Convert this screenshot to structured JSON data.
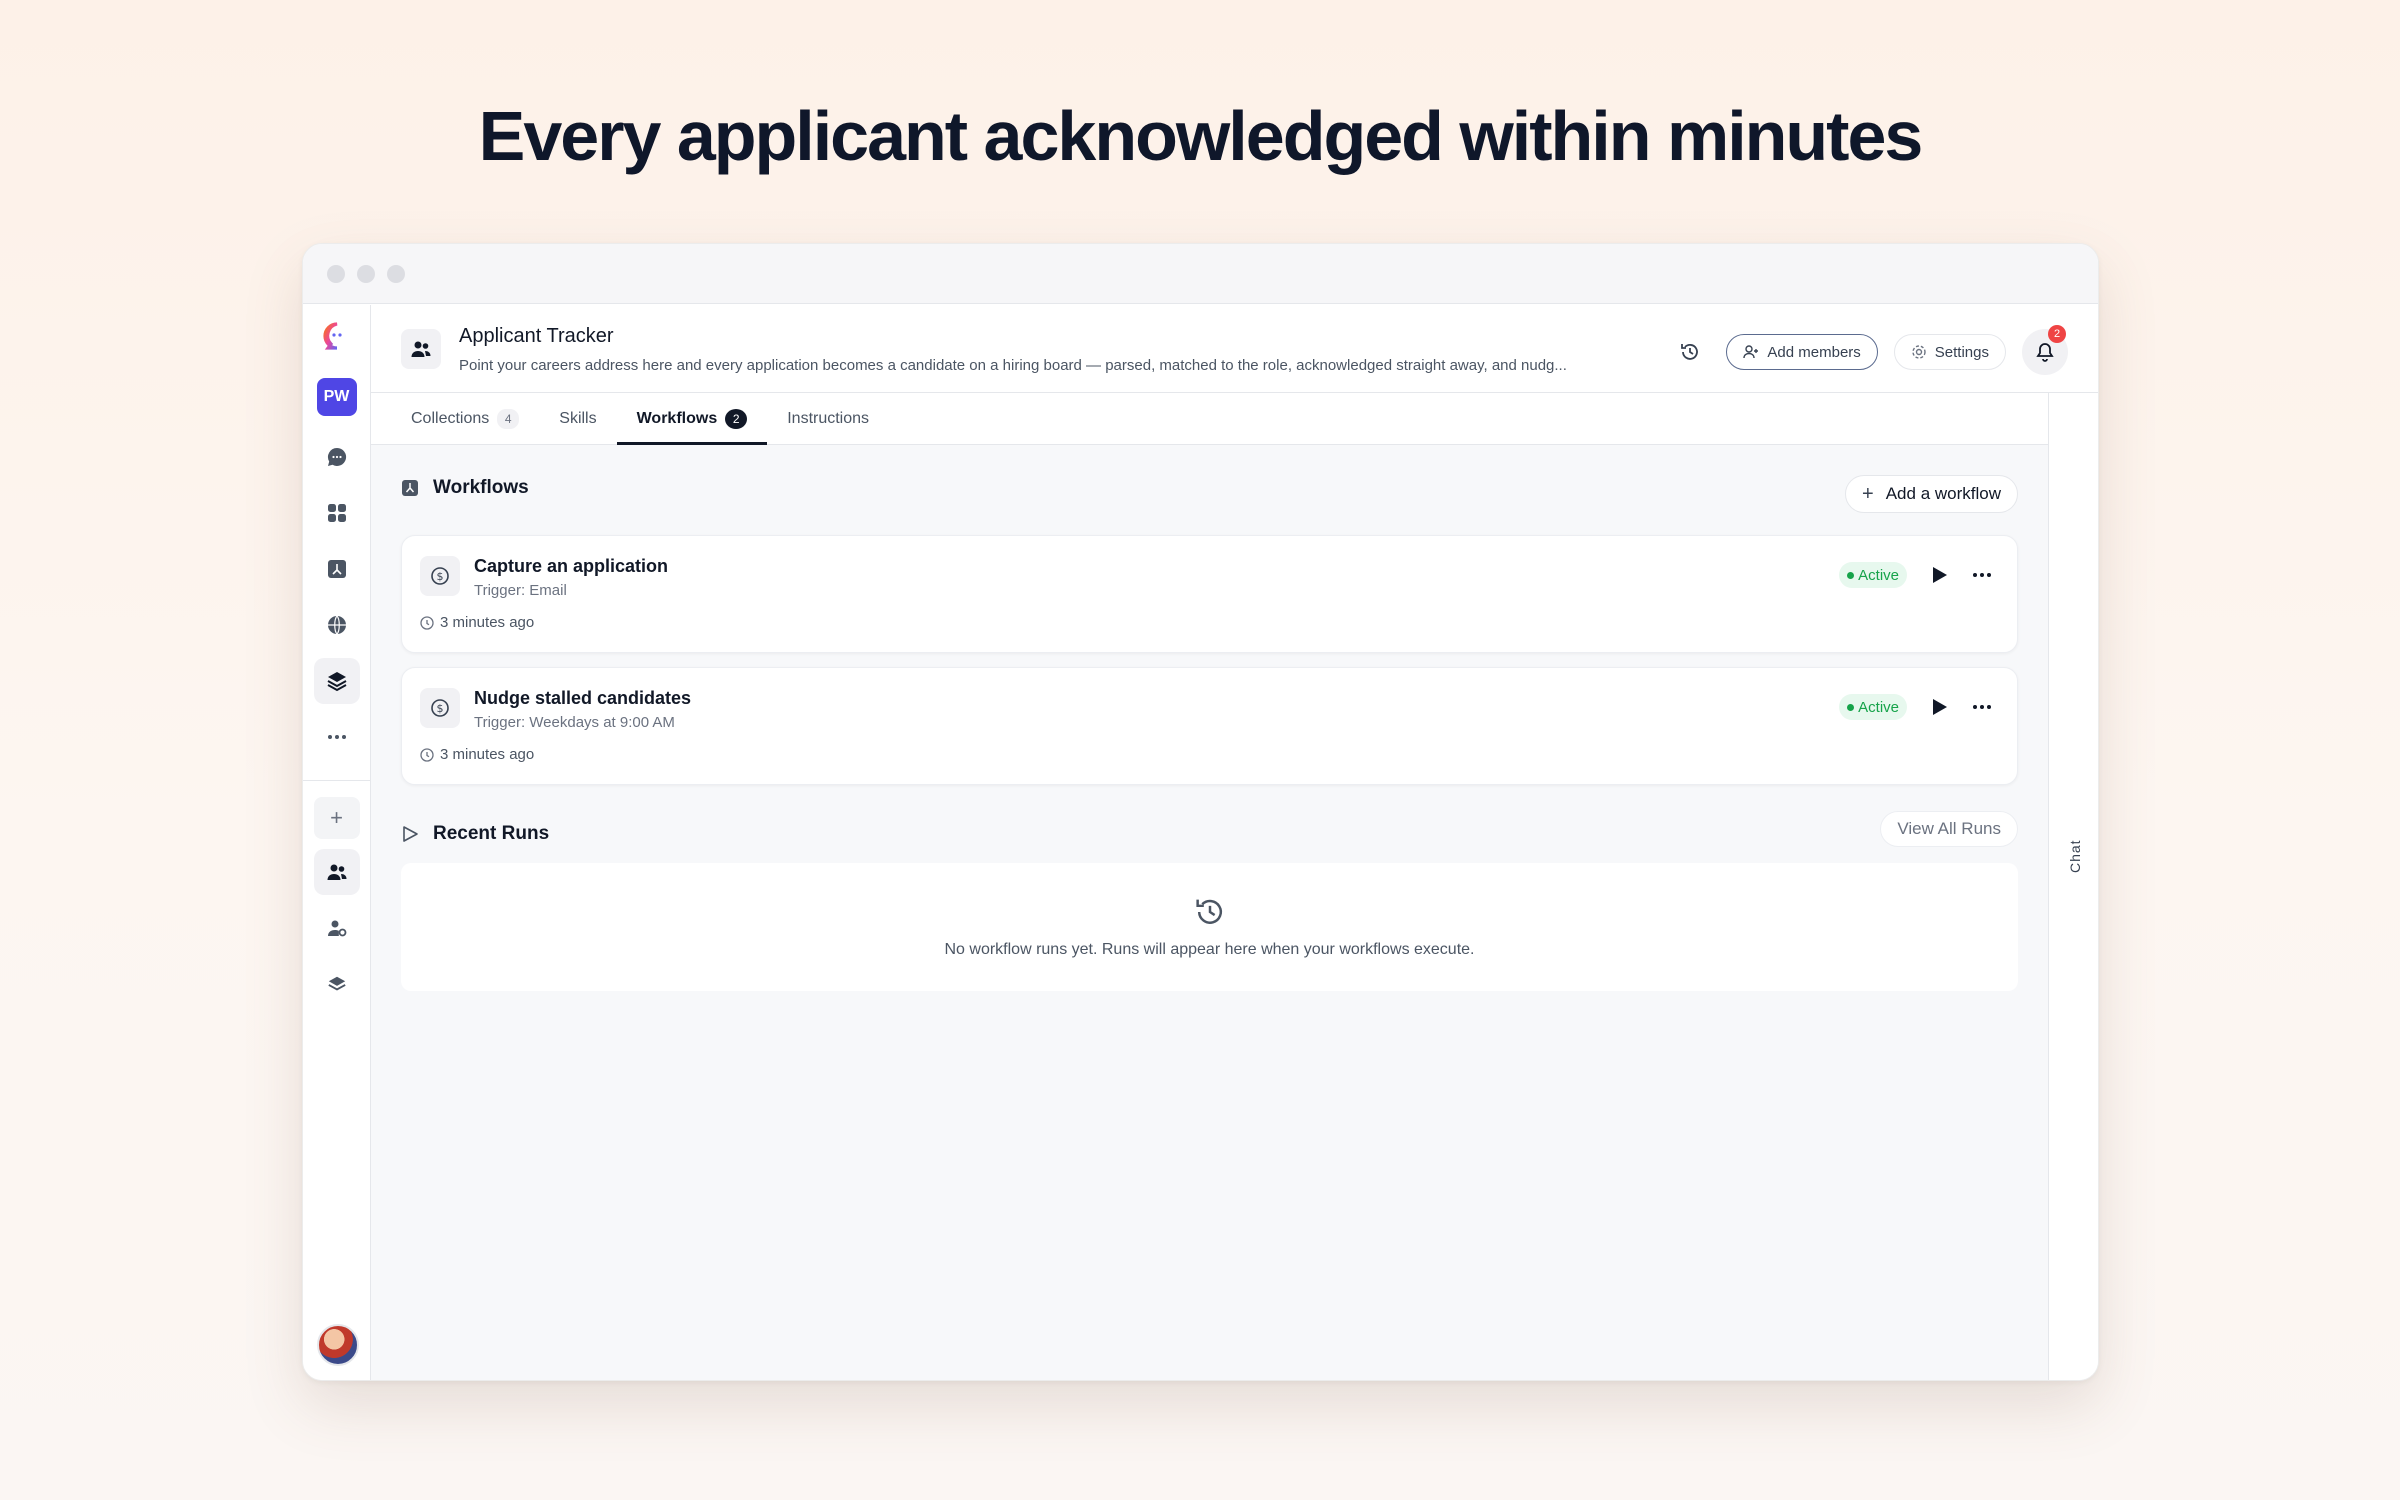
{
  "headline": "Every applicant acknowledged within minutes",
  "rail": {
    "workspace_initials": "PW",
    "icons": [
      "logo-icon",
      "chat-bubble-icon",
      "grid-icon",
      "workflow-icon",
      "globe-icon",
      "layers-icon",
      "more-icon",
      "plus-icon",
      "people-icon",
      "user-settings-icon",
      "stack-icon"
    ]
  },
  "header": {
    "title": "Applicant Tracker",
    "description": "Point your careers address here and every application becomes a candidate on a hiring board — parsed, matched to the role, acknowledged straight away, and nudg...",
    "add_members_label": "Add members",
    "settings_label": "Settings",
    "notification_count": "2"
  },
  "tabs": [
    {
      "label": "Collections",
      "count": "4"
    },
    {
      "label": "Skills",
      "count": ""
    },
    {
      "label": "Workflows",
      "count": "2"
    },
    {
      "label": "Instructions",
      "count": ""
    }
  ],
  "workflows_section": {
    "title": "Workflows",
    "add_label": "Add a workflow",
    "items": [
      {
        "title": "Capture an application",
        "trigger": "Trigger: Email",
        "time": "3 minutes ago",
        "status": "Active"
      },
      {
        "title": "Nudge stalled candidates",
        "trigger": "Trigger: Weekdays at 9:00 AM",
        "time": "3 minutes ago",
        "status": "Active"
      }
    ]
  },
  "runs_section": {
    "title": "Recent Runs",
    "view_all_label": "View All Runs",
    "empty_text": "No workflow runs yet. Runs will appear here when your workflows execute."
  },
  "chat_label": "Chat",
  "colors": {
    "accent": "#4f46e5",
    "active_green": "#16a34a",
    "badge_red": "#ef4444"
  }
}
